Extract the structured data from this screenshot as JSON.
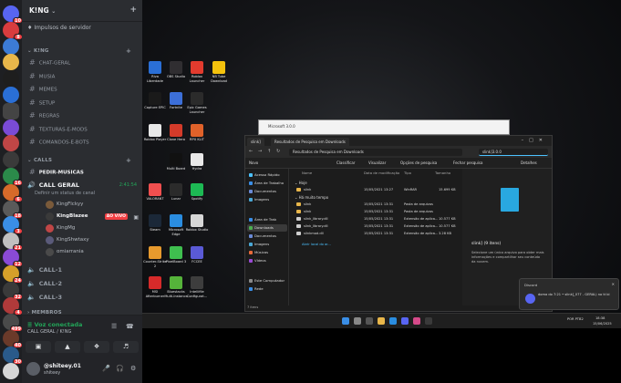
{
  "discord": {
    "server_name": "K!NG",
    "boost_label": "Impulsos de servidor",
    "categories": {
      "king": "K!NG",
      "calls": "CALLS",
      "membros": "MEMBROS"
    },
    "text_channels": [
      "CHAT-GERAL",
      "MUSIA",
      "MEMES",
      "SETUP",
      "REGRAS",
      "TEXTURAS-E-MODS",
      "COMANDOS-E-BOTS"
    ],
    "pedir_musicas": "PEDIR-MUSICAS",
    "voice_active": {
      "name": "CALL GERAL",
      "time": "2:41:54",
      "status_hint": "Definir um status de canal"
    },
    "voice_users": [
      {
        "name": "KingFlckyy",
        "live": false
      },
      {
        "name": "KingBlazee",
        "live": true
      },
      {
        "name": "KingMg",
        "live": false
      },
      {
        "name": "KingShwtaxy",
        "live": false
      },
      {
        "name": "omiarrania",
        "live": false
      }
    ],
    "live_label": "AO VIVO",
    "other_calls": [
      "CALL-1",
      "CALL-2",
      "CALL-3"
    ],
    "voice_bar": {
      "title": "Voz conectada",
      "subtitle": "CALL GERAL / K!NG"
    },
    "user": {
      "name": "@shiteey.01",
      "tag": "shiteey"
    },
    "server_badges": [
      "10",
      "8",
      "",
      "",
      "",
      "",
      "",
      "",
      "",
      "",
      "16",
      "6",
      "18",
      "3",
      "21",
      "12",
      "24",
      "32",
      "4",
      "499",
      "40",
      "30",
      ""
    ]
  },
  "desktop_icons": [
    {
      "label": "Riva Liberdade",
      "color": "#2a6fd6"
    },
    {
      "label": "OBS Studio",
      "color": "#302e31"
    },
    {
      "label": "Roblox Launcher",
      "color": "#e23b2e"
    },
    {
      "label": "NB Tube Download",
      "color": "#f4c20d"
    },
    {
      "label": "Capture EPIC",
      "color": "#1a1a1a"
    },
    {
      "label": "Fortnite",
      "color": "#3c6fd8"
    },
    {
      "label": "Epic Games Launcher",
      "color": "#2b2b2b"
    },
    {
      "label": "",
      "color": "#000000"
    },
    {
      "label": "Roblox Player",
      "color": "#e8e8e8"
    },
    {
      "label": "Clone Hero",
      "color": "#d43b2a"
    },
    {
      "label": "RPX KLIT",
      "color": "#e0622a"
    },
    {
      "label": "",
      "color": "#000000"
    },
    {
      "label": "",
      "color": "#000000"
    },
    {
      "label": "Multi Board",
      "color": "#111111"
    },
    {
      "label": "Hydra",
      "color": "#e8e8e8"
    },
    {
      "label": "",
      "color": "#000000"
    },
    {
      "label": "VALORANT",
      "color": "#f04f4f"
    },
    {
      "label": "Lunar",
      "color": "#2b2b2b"
    },
    {
      "label": "Spotify",
      "color": "#1db954"
    },
    {
      "label": "",
      "color": "#000000"
    },
    {
      "label": "Steam",
      "color": "#1b2838"
    },
    {
      "label": "Microsoft Edge",
      "color": "#2a8de0"
    },
    {
      "label": "Roblox Studio",
      "color": "#d6d6d6"
    },
    {
      "label": "",
      "color": "#000000"
    },
    {
      "label": "Counter-Strike 2",
      "color": "#e79a2d"
    },
    {
      "label": "PixelBoard 3",
      "color": "#3fbf4f"
    },
    {
      "label": "FCCEE",
      "color": "#5a5ad6"
    },
    {
      "label": "",
      "color": "#000000"
    },
    {
      "label": "MSI Afterburner",
      "color": "#d62a2a"
    },
    {
      "label": "Bluestacks Multi-Instance",
      "color": "#55b33a"
    },
    {
      "label": "Intellifile Configurat...",
      "color": "#3d3d3d"
    },
    {
      "label": "",
      "color": "#000000"
    }
  ],
  "small_window_title": "Microsoft 3.0.0",
  "explorer": {
    "tabs": [
      "slink]",
      "Resultados de Pesquisa em Downloads"
    ],
    "path": "Resultados de Pesquisa em Downloads",
    "search_value": "slink]3.0.0",
    "commands": [
      "Novo",
      "Classificar",
      "Visualizar",
      "Opções de pesquisa",
      "Fechar pesquisa",
      "Detalhes"
    ],
    "sidebar": [
      "Acesso Rápido",
      "Área de Trabalho",
      "Documentos",
      "Imagens",
      "Área de Trab",
      "Downloads",
      "Documentos",
      "Imagens",
      "Músicas",
      "Vídeos",
      "Este Computador",
      "Rede"
    ],
    "columns": [
      "Nome",
      "Data de modificação",
      "Tipo",
      "Tamanho"
    ],
    "group_today": "Hoje",
    "group_older": "Há muito tempo",
    "rows": [
      {
        "name": "slink",
        "date": "15/05/2021 13:27",
        "type": "WinRAR",
        "size": "15.699 KB"
      },
      {
        "name": "slink",
        "date": "15/05/2021 13:31",
        "type": "Pasta de arquivos",
        "size": ""
      },
      {
        "name": "slink",
        "date": "15/05/2021 13:31",
        "type": "Pasta de arquivos",
        "size": ""
      },
      {
        "name": "slink_library.dll",
        "date": "15/05/2021 13:31",
        "type": "Extensão de aplica...",
        "size": "10.577 KB"
      },
      {
        "name": "slink_library.dll",
        "date": "15/05/2021 13:31",
        "type": "Extensão de aplica...",
        "size": "10.577 KB"
      },
      {
        "name": "slinkmod.dll",
        "date": "15/05/2021 13:31",
        "type": "Extensão de aplica...",
        "size": "3.28 KB"
      }
    ],
    "open_location": "Abrir local do ar...",
    "preview_name": "slink] (9 itens)",
    "preview_desc": "Selecione um único arquivo para obter mais informações e compartilhar seu conteúdo da nuvem.",
    "status": "7 itens"
  },
  "toast": {
    "app": "Discord",
    "message": "doma do 7:21 • slink]_077 - GERAL) no tt bi"
  },
  "taskbar": {
    "lang": "POR PTB2",
    "time": "18:38",
    "date": "15/06/2025"
  }
}
